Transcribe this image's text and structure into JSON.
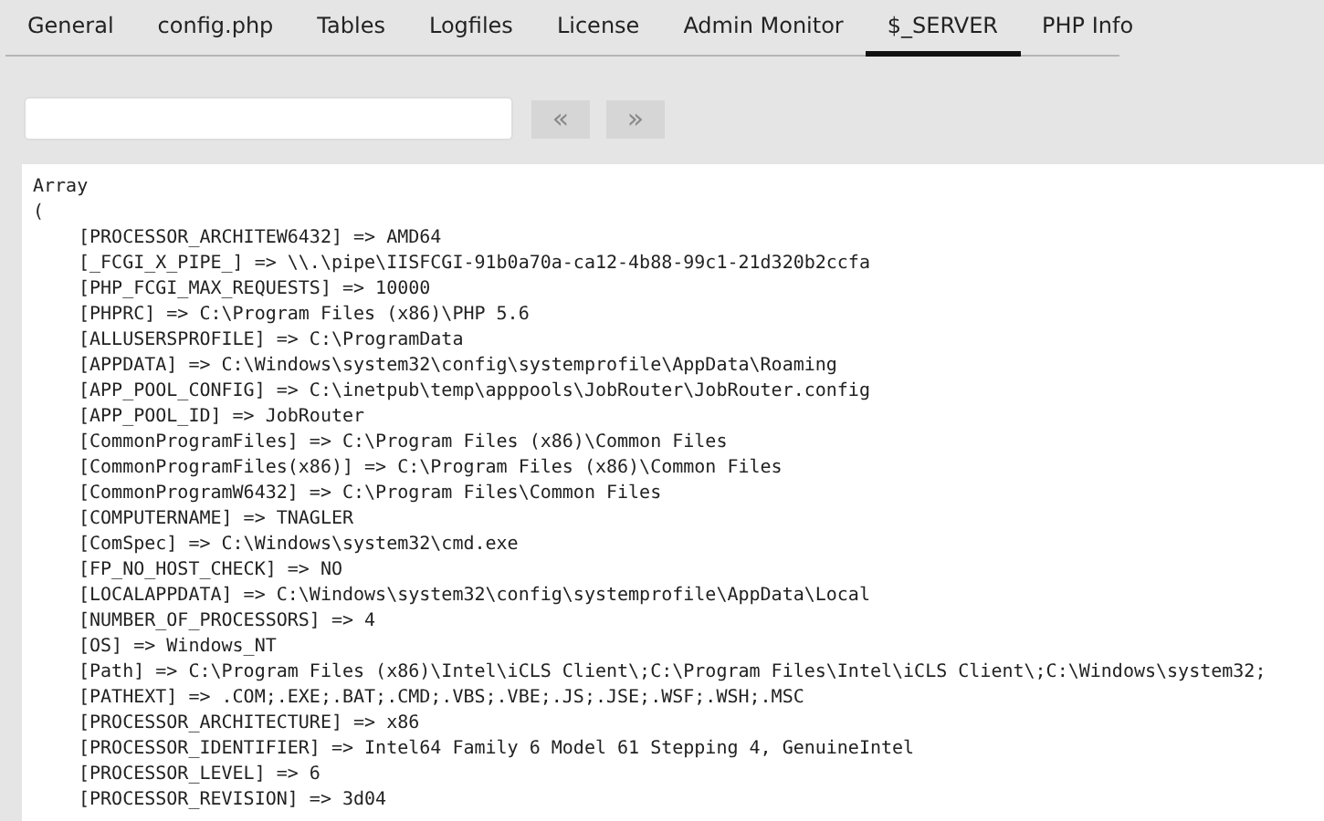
{
  "tabs": [
    {
      "label": "General",
      "selected": false
    },
    {
      "label": "config.php",
      "selected": false
    },
    {
      "label": "Tables",
      "selected": false
    },
    {
      "label": "Logfiles",
      "selected": false
    },
    {
      "label": "License",
      "selected": false
    },
    {
      "label": "Admin Monitor",
      "selected": false
    },
    {
      "label": "$_SERVER",
      "selected": true
    },
    {
      "label": "PHP Info",
      "selected": false
    }
  ],
  "pager": {
    "prev": "«",
    "next": "»"
  },
  "output": {
    "header": [
      "Array",
      "("
    ],
    "entries": [
      "[PROCESSOR_ARCHITEW6432] => AMD64",
      "[_FCGI_X_PIPE_] => \\\\.\\pipe\\IISFCGI-91b0a70a-ca12-4b88-99c1-21d320b2ccfa",
      "[PHP_FCGI_MAX_REQUESTS] => 10000",
      "[PHPRC] => C:\\Program Files (x86)\\PHP 5.6",
      "[ALLUSERSPROFILE] => C:\\ProgramData",
      "[APPDATA] => C:\\Windows\\system32\\config\\systemprofile\\AppData\\Roaming",
      "[APP_POOL_CONFIG] => C:\\inetpub\\temp\\apppools\\JobRouter\\JobRouter.config",
      "[APP_POOL_ID] => JobRouter",
      "[CommonProgramFiles] => C:\\Program Files (x86)\\Common Files",
      "[CommonProgramFiles(x86)] => C:\\Program Files (x86)\\Common Files",
      "[CommonProgramW6432] => C:\\Program Files\\Common Files",
      "[COMPUTERNAME] => TNAGLER",
      "[ComSpec] => C:\\Windows\\system32\\cmd.exe",
      "[FP_NO_HOST_CHECK] => NO",
      "[LOCALAPPDATA] => C:\\Windows\\system32\\config\\systemprofile\\AppData\\Local",
      "[NUMBER_OF_PROCESSORS] => 4",
      "[OS] => Windows_NT",
      "[Path] => C:\\Program Files (x86)\\Intel\\iCLS Client\\;C:\\Program Files\\Intel\\iCLS Client\\;C:\\Windows\\system32;",
      "[PATHEXT] => .COM;.EXE;.BAT;.CMD;.VBS;.VBE;.JS;.JSE;.WSF;.WSH;.MSC",
      "[PROCESSOR_ARCHITECTURE] => x86",
      "[PROCESSOR_IDENTIFIER] => Intel64 Family 6 Model 61 Stepping 4, GenuineIntel",
      "[PROCESSOR_LEVEL] => 6",
      "[PROCESSOR_REVISION] => 3d04"
    ]
  }
}
